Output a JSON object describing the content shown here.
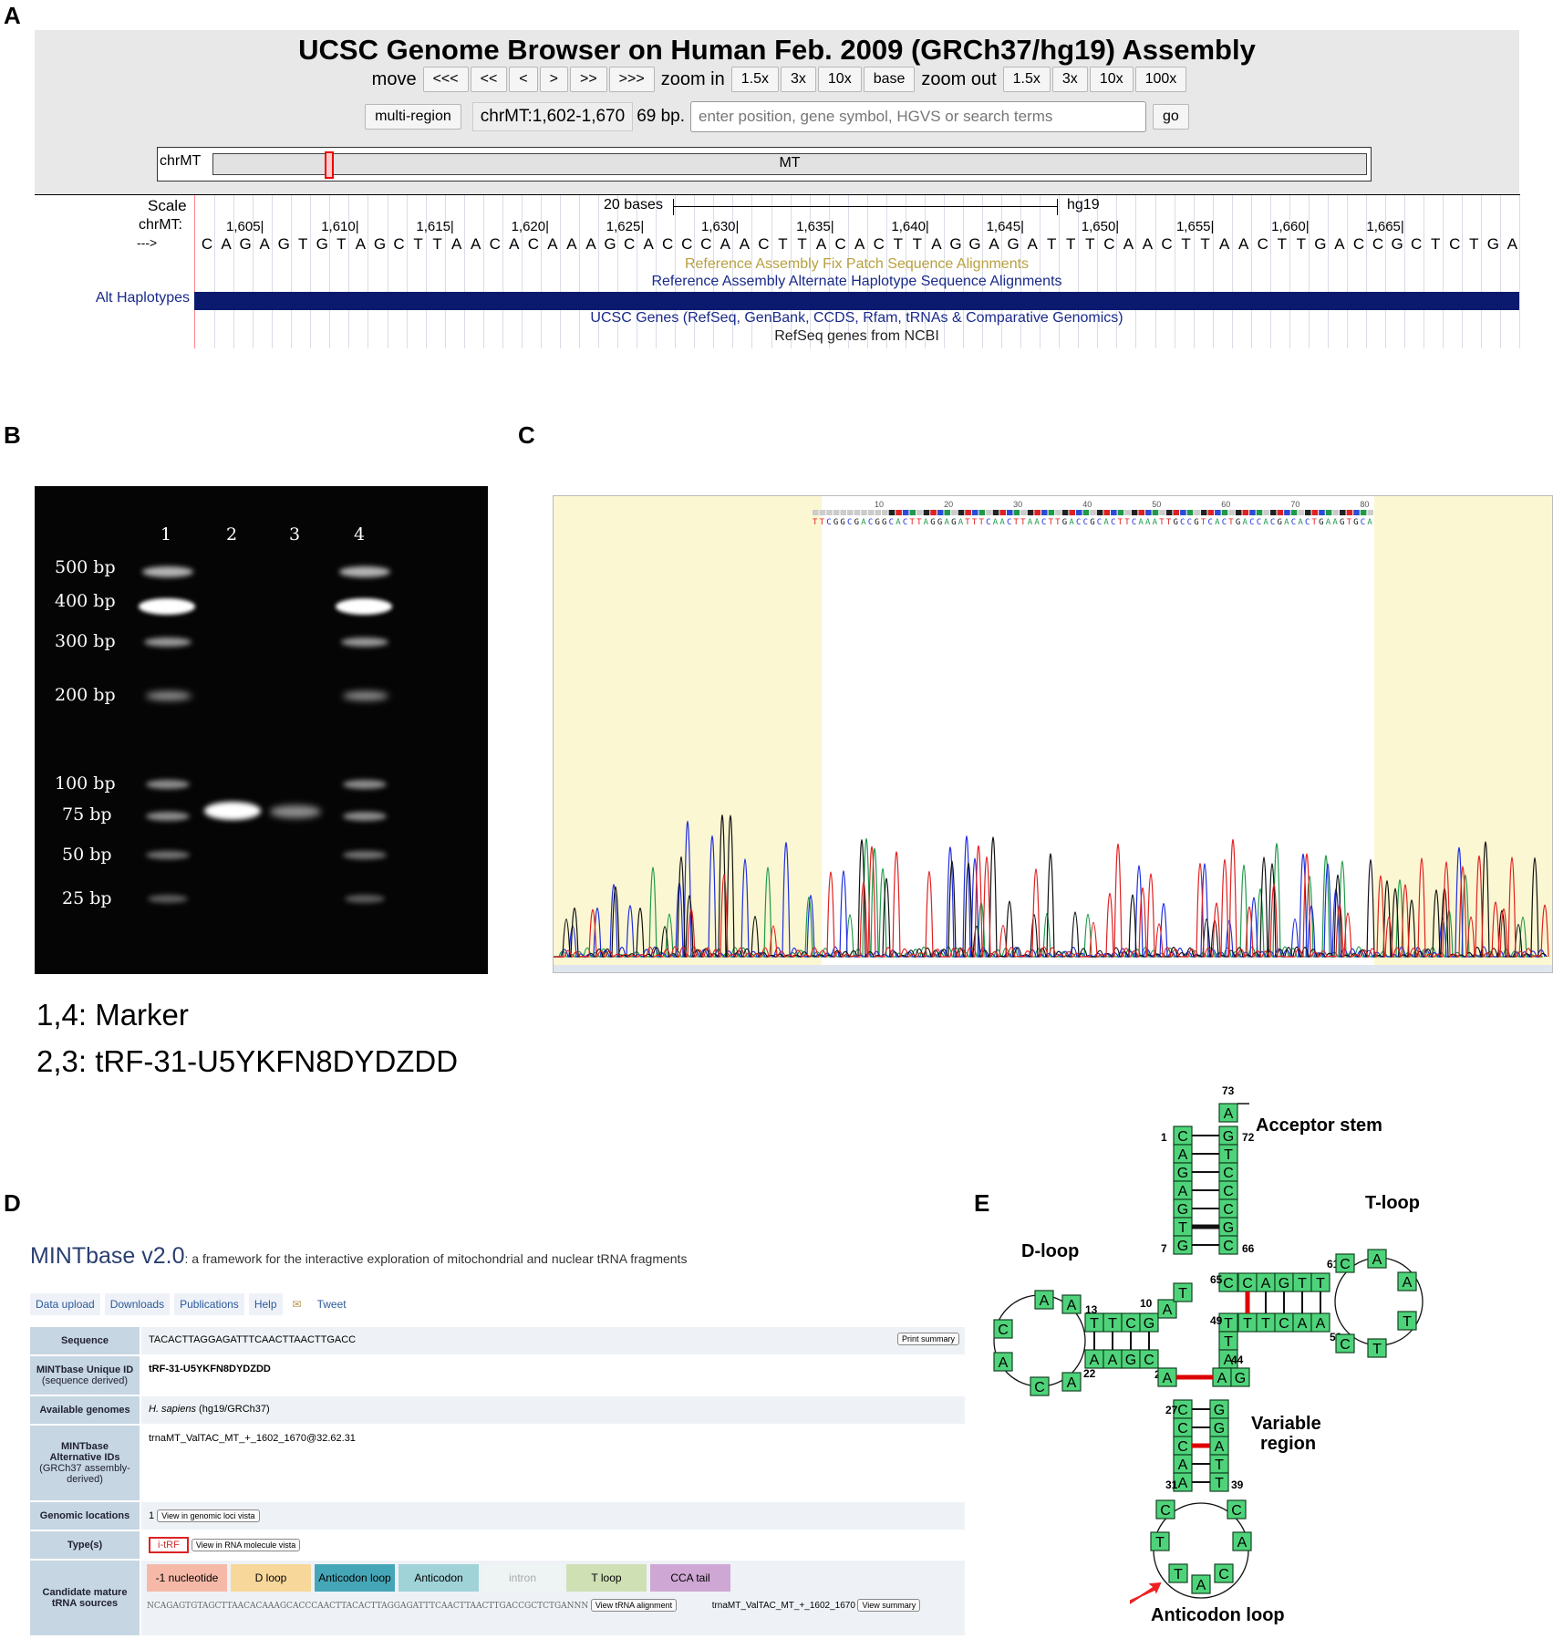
{
  "panels": {
    "a": "A",
    "b": "B",
    "c": "C",
    "d": "D",
    "e": "E"
  },
  "ucsc": {
    "title": "UCSC Genome Browser on Human Feb. 2009 (GRCh37/hg19) Assembly",
    "move_label": "move",
    "move_buttons": [
      "<<<",
      "<<",
      "<",
      ">",
      ">>",
      ">>>"
    ],
    "zoom_in_label": "zoom in",
    "zoom_in_buttons": [
      "1.5x",
      "3x",
      "10x",
      "base"
    ],
    "zoom_out_label": "zoom out",
    "zoom_out_buttons": [
      "1.5x",
      "3x",
      "10x",
      "100x"
    ],
    "multi_region": "multi-region",
    "position": "chrMT:1,602-1,670",
    "size": "69 bp.",
    "search_placeholder": "enter position, gene symbol, HGVS or search terms",
    "go": "go",
    "ideogram_chrom": "chrMT",
    "ideogram_label": "MT",
    "scale_label": "Scale",
    "chrom_label": "chrMT:",
    "arrow_label": "--->",
    "scale_bar": "20 bases",
    "assembly": "hg19",
    "ticks": [
      "1,605|",
      "1,610|",
      "1,615|",
      "1,620|",
      "1,625|",
      "1,630|",
      "1,635|",
      "1,640|",
      "1,645|",
      "1,650|",
      "1,655|",
      "1,660|",
      "1,665|"
    ],
    "sequence": "CAGAGTGTAGCTTAACACAAAGCACCCAACTTACACTTAGGAGATTTCAACTTAACTTGACCGCTCTGA",
    "track_fix": "Reference Assembly Fix Patch Sequence Alignments",
    "track_alt": "Reference Assembly Alternate Haplotype Sequence Alignments",
    "alt_haplotypes": "Alt Haplotypes",
    "track_ucsc_genes": "UCSC Genes (RefSeq, GenBank, CCDS, Rfam, tRNAs & Comparative Genomics)",
    "track_refseq": "RefSeq genes from NCBI"
  },
  "gel": {
    "lanes": [
      "1",
      "2",
      "3",
      "4"
    ],
    "markers": [
      "500  bp",
      "400  bp",
      "300  bp",
      "200  bp",
      "100  bp",
      "75  bp",
      "50  bp",
      "25  bp"
    ],
    "legend_markers": "1,4: Marker",
    "legend_samples": "2,3: tRF-31-U5YKFN8DYDZDD"
  },
  "chromatogram": {
    "ruler": [
      "10",
      "20",
      "30",
      "40",
      "50",
      "60",
      "70",
      "80"
    ],
    "called_sequence": "TTCGGCGACGGCACTTAGGAGATTTCAACTTAACTTGACCGCACTTCAAATTGCCGTCACTGACCACGACACTGAAGTGCA",
    "colors": {
      "A": "#1f9a4a",
      "C": "#1e2ee0",
      "G": "#111111",
      "T": "#e02020"
    }
  },
  "mintbase": {
    "title": "MINTbase v2.0",
    "subtitle": ": a framework for the interactive exploration of mitochondrial and nuclear tRNA fragments",
    "nav": [
      "Data upload",
      "Downloads",
      "Publications",
      "Help",
      "Tweet"
    ],
    "rows": [
      {
        "key": "Sequence",
        "value": "TACACTTAGGAGATTTCAACTTAACTTGACC",
        "button": "Print summary"
      },
      {
        "key": "MINTbase Unique ID",
        "key2": "(sequence derived)",
        "value": "tRF-31-U5YKFN8DYDZDD"
      },
      {
        "key": "Available genomes",
        "value": "H. sapiens",
        "value2": "(hg19/GRCh37)"
      },
      {
        "key": "MINTbase",
        "key2": "Alternative IDs",
        "key3": "(GRCh37 assembly-",
        "key4": "derived)",
        "value": "trnaMT_ValTAC_MT_+_1602_1670@32.62.31"
      },
      {
        "key": "Genomic locations",
        "value": "1",
        "button": "View in genomic loci vista"
      },
      {
        "key": "Type(s)",
        "value": "i-tRF",
        "button": "View in RNA molecule vista"
      },
      {
        "key": "Candidate mature",
        "key2": "tRNA sources",
        "chips": [
          "-1 nucleotide",
          "D loop",
          "Anticodon loop",
          "Anticodon",
          "intron",
          "T loop",
          "CCA tail"
        ],
        "source_seq": "NCAGAGTGTAGCTTAACACAAAGCACCCAACTTACACTTAGGAGATTTCAACTTAACTTGACCGCTCTGANNN",
        "align_button": "View tRNA alignment",
        "source_name": "trnaMT_ValTAC_MT_+_1602_1670",
        "summary_button": "View summary"
      }
    ],
    "chip_colors": [
      "#f6b9a8",
      "#f8d89a",
      "#45a6b8",
      "#9fd3d8",
      "#eef3f3",
      "#cfe0b5",
      "#cfa7d4"
    ]
  },
  "trna": {
    "acceptor_stem": "Acceptor stem",
    "t_loop": "T-loop",
    "d_loop": "D-loop",
    "variable_region_1": "Variable",
    "variable_region_2": "region",
    "anticodon_loop": "Anticodon loop",
    "positions": [
      "73",
      "1",
      "72",
      "7",
      "66",
      "65",
      "61",
      "10",
      "13",
      "49",
      "53",
      "22",
      "25",
      "44",
      "27",
      "31",
      "39"
    ]
  }
}
